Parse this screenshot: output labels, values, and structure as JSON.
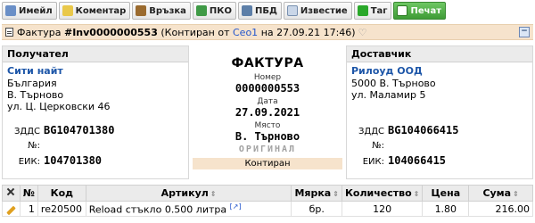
{
  "toolbar": {
    "buttons": [
      {
        "label": "Имейл",
        "icon": "email-icon"
      },
      {
        "label": "Коментар",
        "icon": "comment-icon"
      },
      {
        "label": "Връзка",
        "icon": "link-icon"
      },
      {
        "label": "ПКО",
        "icon": "pko-icon"
      },
      {
        "label": "ПБД",
        "icon": "pbd-icon"
      },
      {
        "label": "Известие",
        "icon": "notice-icon"
      },
      {
        "label": "Таг",
        "icon": "tag-icon"
      },
      {
        "label": "Печат",
        "icon": "print-icon"
      }
    ]
  },
  "header": {
    "prefix": "Фактура",
    "number": "#Inv0000000553",
    "status_open": "(Контиран от",
    "user": "Ceo1",
    "date_text": "на 27.09.21 17:46)",
    "collapse": "−"
  },
  "recipient": {
    "heading": "Получател",
    "name": "Сити найт",
    "country": "България",
    "city": "В. Търново",
    "street": "ул. Ц. Церковски 46",
    "vat_label": "ЗДДС №:",
    "vat": "BG104701380",
    "eik_label": "ЕИК:",
    "eik": "104701380"
  },
  "document": {
    "title": "ФАКТУРА",
    "number_label": "Номер",
    "number": "0000000553",
    "date_label": "Дата",
    "date": "27.09.2021",
    "place_label": "Място",
    "place": "В. Търново",
    "original": "ОРИГИНАЛ",
    "status": "Контиран"
  },
  "supplier": {
    "heading": "Доставчик",
    "name": "Рилоуд ООД",
    "city": "5000 В. Търново",
    "street": "ул. Маламир 5",
    "vat_label": "ЗДДС №:",
    "vat": "BG104066415",
    "eik_label": "ЕИК:",
    "eik": "104066415"
  },
  "items": {
    "columns": [
      "№",
      "Код",
      "Артикул",
      "Мярка",
      "Количество",
      "Цена",
      "Сума"
    ],
    "rows": [
      {
        "no": "1",
        "code": "re20500",
        "article": "Reload стъкло 0.500 литра",
        "link": "[↗]",
        "unit": "бр.",
        "qty": "120",
        "price": "1.80",
        "amount": "216.00"
      }
    ]
  }
}
